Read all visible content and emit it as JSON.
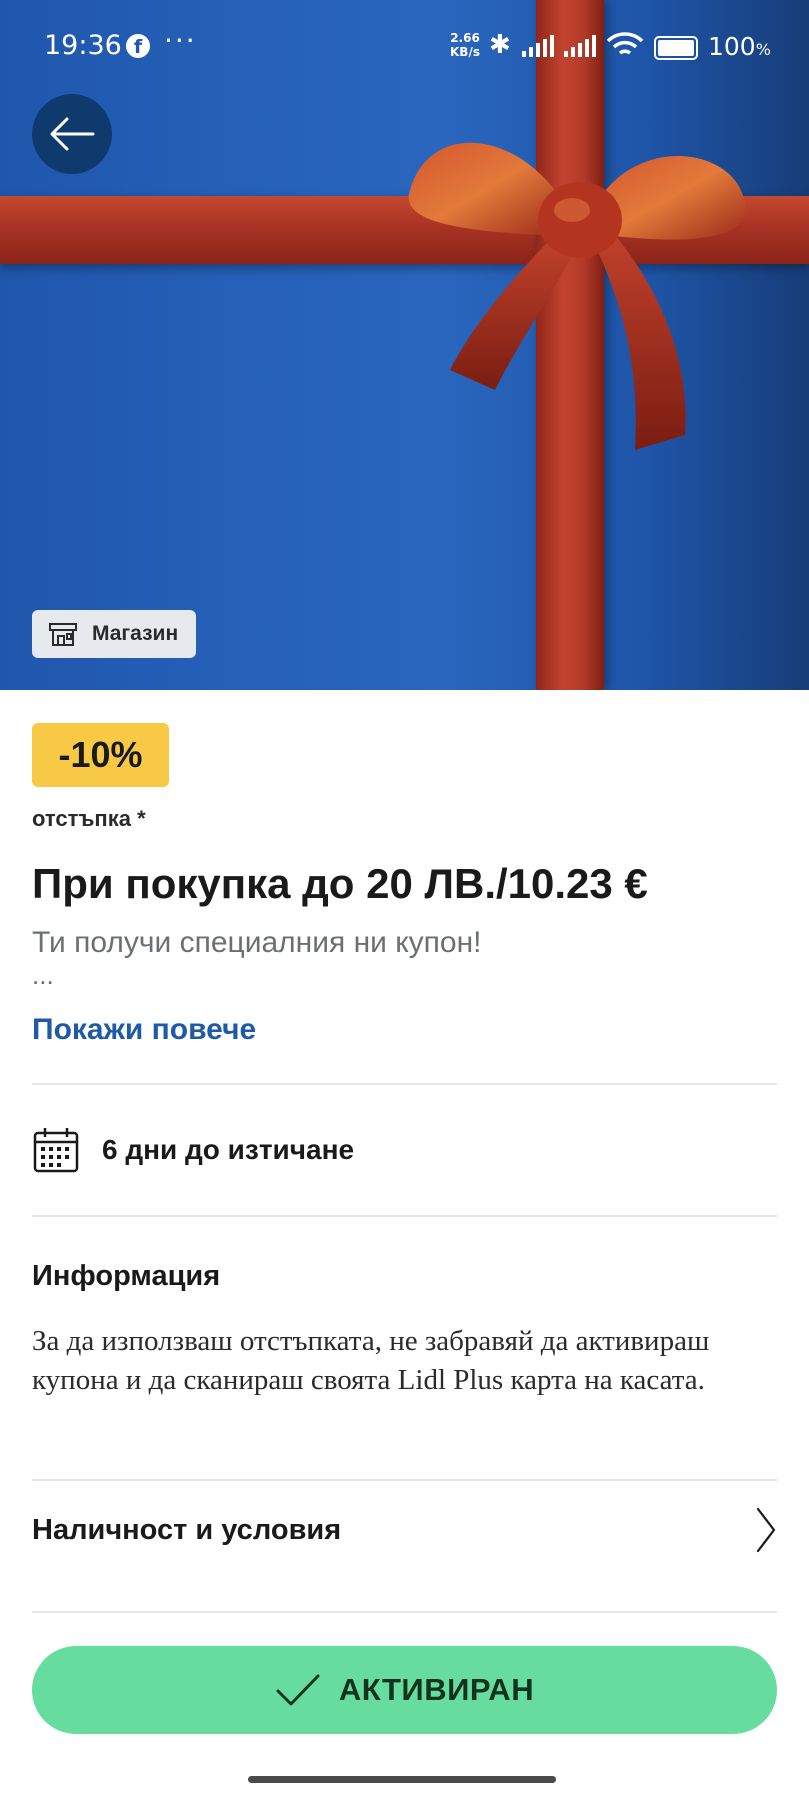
{
  "status_bar": {
    "time": "19:36",
    "notification_icon": "facebook-icon",
    "more_dots": "···",
    "network_speed_value": "2.66",
    "network_speed_unit": "KB/s",
    "battery_percent": "100",
    "battery_unit": "%"
  },
  "hero": {
    "back_icon": "arrow-left-icon",
    "store_chip_icon": "store-icon",
    "store_chip_label": "Магазин",
    "colors": {
      "background": "#2a66be",
      "ribbon": "#b33a29"
    }
  },
  "coupon": {
    "discount_badge": "-10%",
    "discount_label": "отстъпка *",
    "title": "При покупка до 20 ЛВ./10.23 €",
    "subtitle": "Ти получи специалния ни купон!",
    "ellipsis": "...",
    "show_more_label": "Покажи повече",
    "badge_color": "#f7c945",
    "link_color": "#1f5aa6"
  },
  "expiry": {
    "icon": "calendar-icon",
    "text": "6 дни до изтичане"
  },
  "info": {
    "heading": "Информация",
    "text": "За да използваш отстъпката, не забравяй да активираш купона и да сканираш своята Lidl Plus карта на касата."
  },
  "terms": {
    "label": "Наличност и условия",
    "icon": "chevron-right-icon"
  },
  "action": {
    "label": "АКТИВИРАН",
    "icon": "checkmark-icon",
    "color": "#66dd9e"
  }
}
